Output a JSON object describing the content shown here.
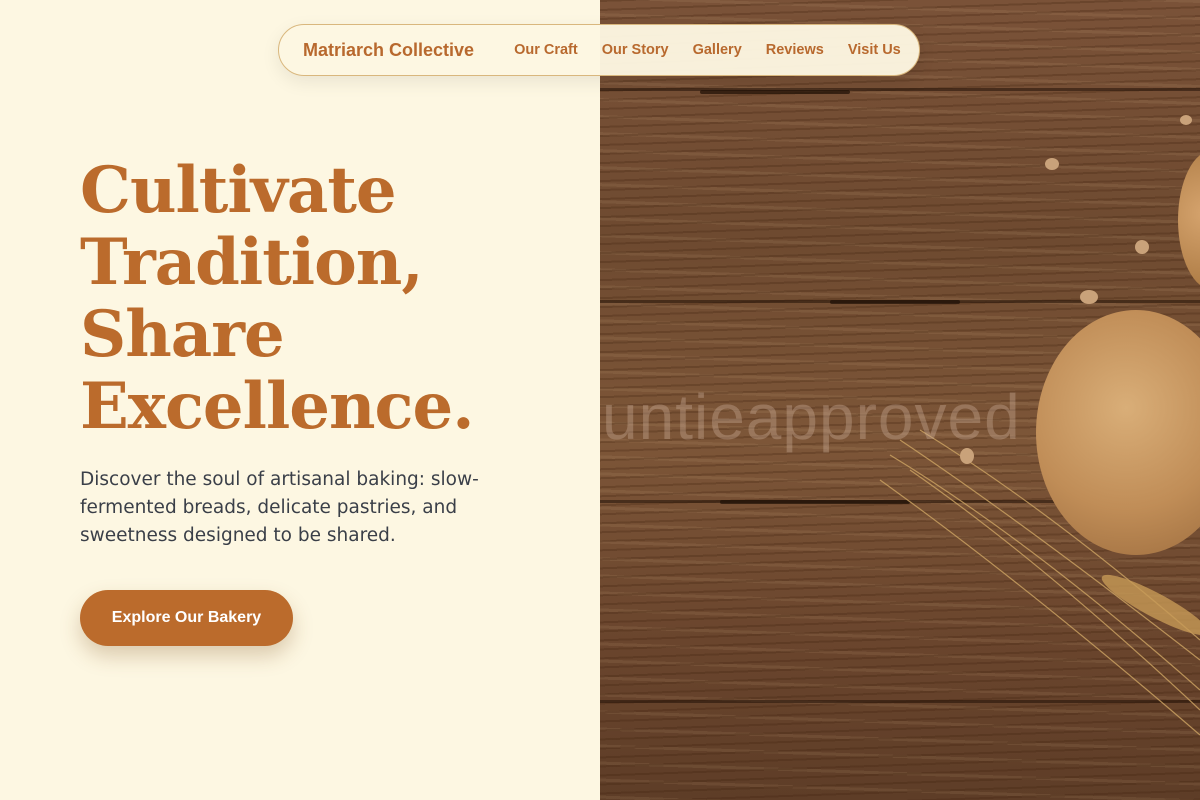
{
  "nav": {
    "brand": "Matriarch Collective",
    "links": [
      "Our Craft",
      "Our Story",
      "Gallery",
      "Reviews",
      "Visit Us"
    ]
  },
  "hero": {
    "headline_lines": [
      "Cultivate",
      "Tradition,",
      "Share",
      "Excellence."
    ],
    "description": "Discover the soul of artisanal baking: slow-fermented breads, delicate pastries, and sweetness designed to be shared.",
    "cta_label": "Explore Our Bakery"
  },
  "image": {
    "watermark": "untieapproved"
  },
  "colors": {
    "background": "#fdf7e2",
    "accent": "#bb6b2c",
    "text": "#3a3f48",
    "nav_border": "#d9b77d"
  }
}
